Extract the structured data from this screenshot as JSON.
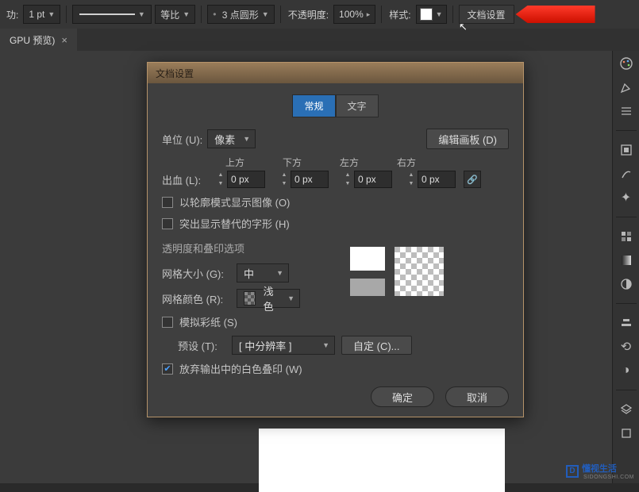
{
  "toolbar": {
    "leading_label": "功:",
    "stroke_weight": "1 pt",
    "proportion": "等比",
    "dash_pattern": "3 点圆形",
    "opacity_label": "不透明度:",
    "opacity_value": "100%",
    "style_label": "样式:",
    "doc_settings_btn": "文档设置"
  },
  "tab": {
    "title": "GPU 预览)"
  },
  "dialog": {
    "title": "文档设置",
    "tabs": {
      "general": "常规",
      "type": "文字"
    },
    "units_label": "单位 (U):",
    "units_value": "像素",
    "edit_artboard": "编辑画板 (D)",
    "bleed_label": "出血 (L):",
    "bleed_headers": {
      "top": "上方",
      "bottom": "下方",
      "left": "左方",
      "right": "右方"
    },
    "bleed_values": {
      "top": "0 px",
      "bottom": "0 px",
      "left": "0 px",
      "right": "0 px"
    },
    "show_outline": "以轮廓模式显示图像 (O)",
    "highlight_sub": "突出显示替代的字形 (H)",
    "section_transparency": "透明度和叠印选项",
    "grid_size_label": "网格大小 (G):",
    "grid_size_value": "中",
    "grid_color_label": "网格颜色 (R):",
    "grid_color_value": "浅色",
    "simulate_paper": "模拟彩纸 (S)",
    "preset_label": "预设 (T):",
    "preset_value": "[ 中分辨率 ]",
    "custom_btn": "自定 (C)...",
    "discard_white": "放弃输出中的白色叠印 (W)",
    "ok": "确定",
    "cancel": "取消"
  },
  "watermark": {
    "text": "懂视生活",
    "url": "SIDONGSHI.COM",
    "icon": "D"
  }
}
